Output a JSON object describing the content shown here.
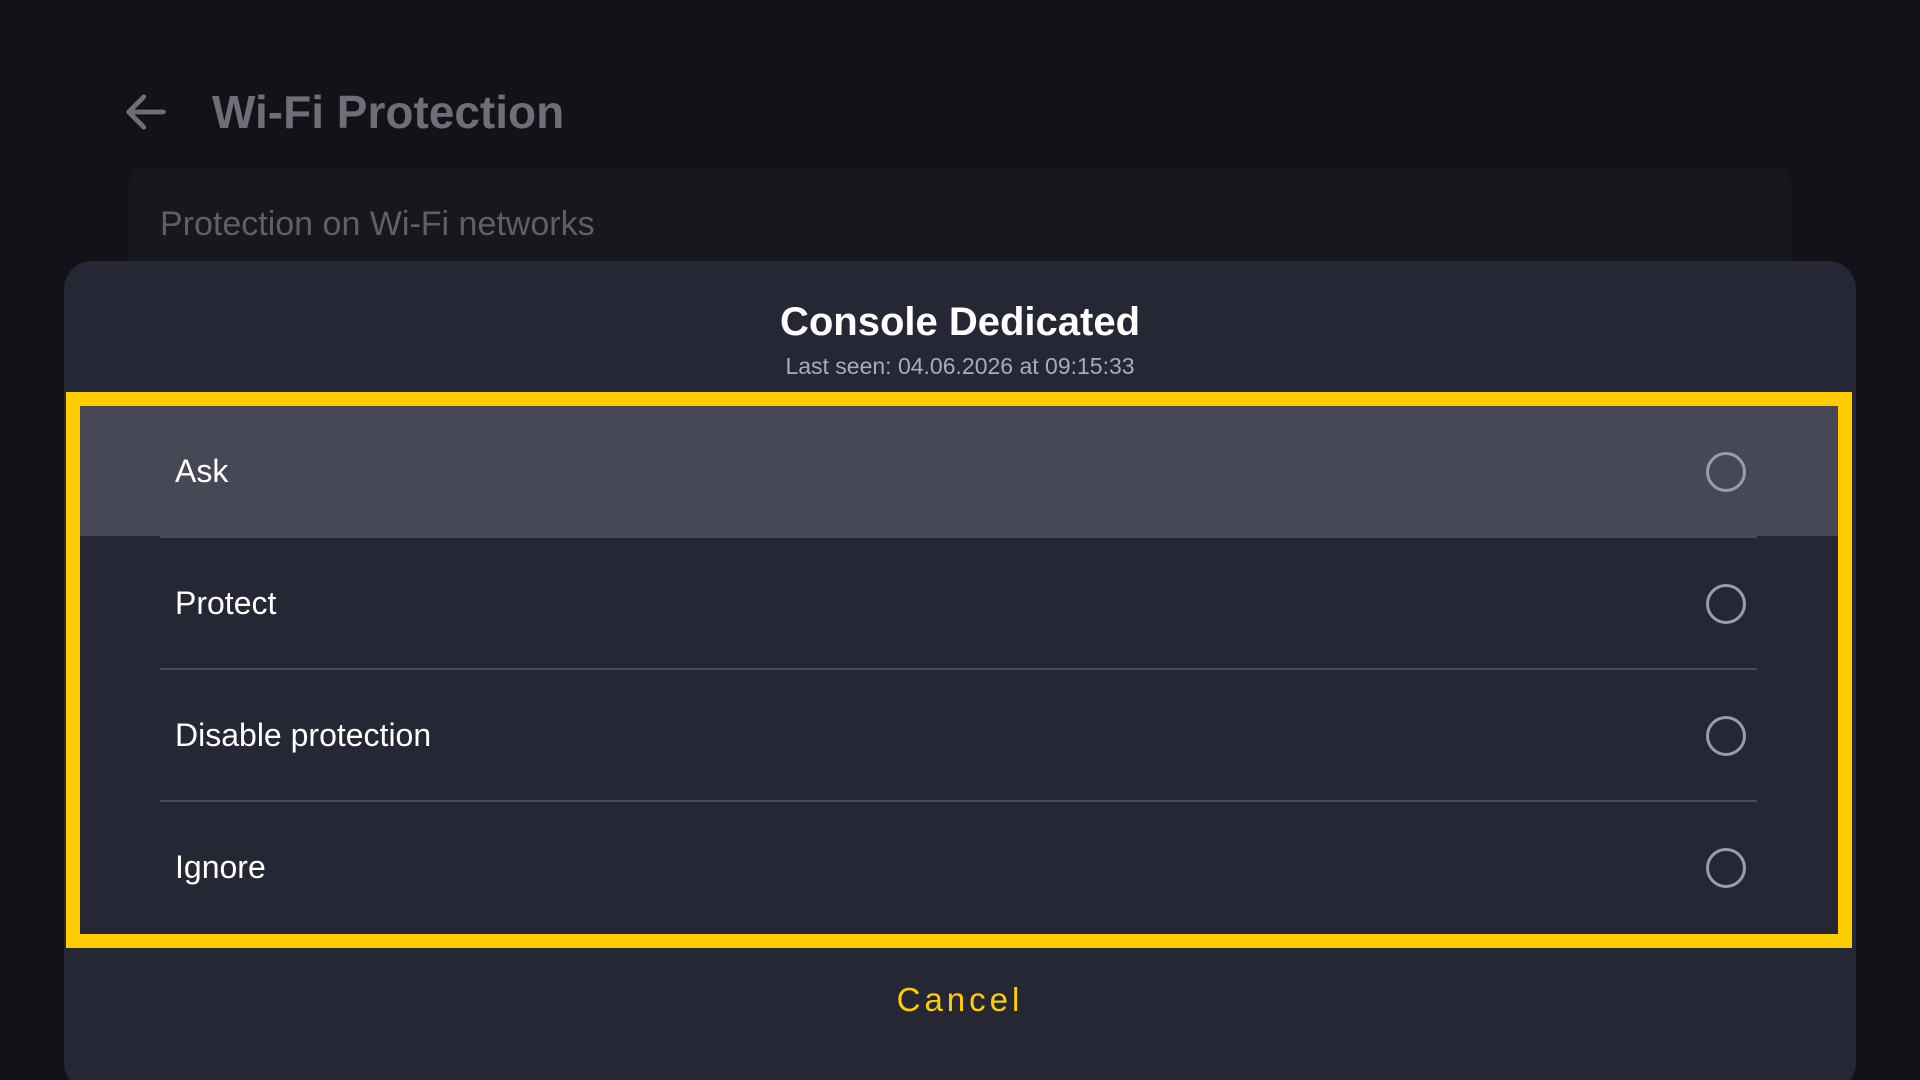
{
  "header": {
    "title": "Wi-Fi Protection",
    "back_icon": "arrow-left-icon"
  },
  "background": {
    "section_label": "Protection on Wi-Fi networks"
  },
  "dialog": {
    "title": "Console Dedicated",
    "subtitle": "Last seen: 04.06.2026 at 09:15:33",
    "options": [
      {
        "label": "Ask",
        "selected": false,
        "focused": true
      },
      {
        "label": "Protect",
        "selected": false,
        "focused": false
      },
      {
        "label": "Disable protection",
        "selected": false,
        "focused": false
      },
      {
        "label": "Ignore",
        "selected": false,
        "focused": false
      }
    ],
    "cancel_label": "Cancel"
  },
  "colors": {
    "accent": "#ffcc00",
    "dialog_bg": "#252734",
    "page_bg": "#121218",
    "focused_row": "#474855"
  }
}
